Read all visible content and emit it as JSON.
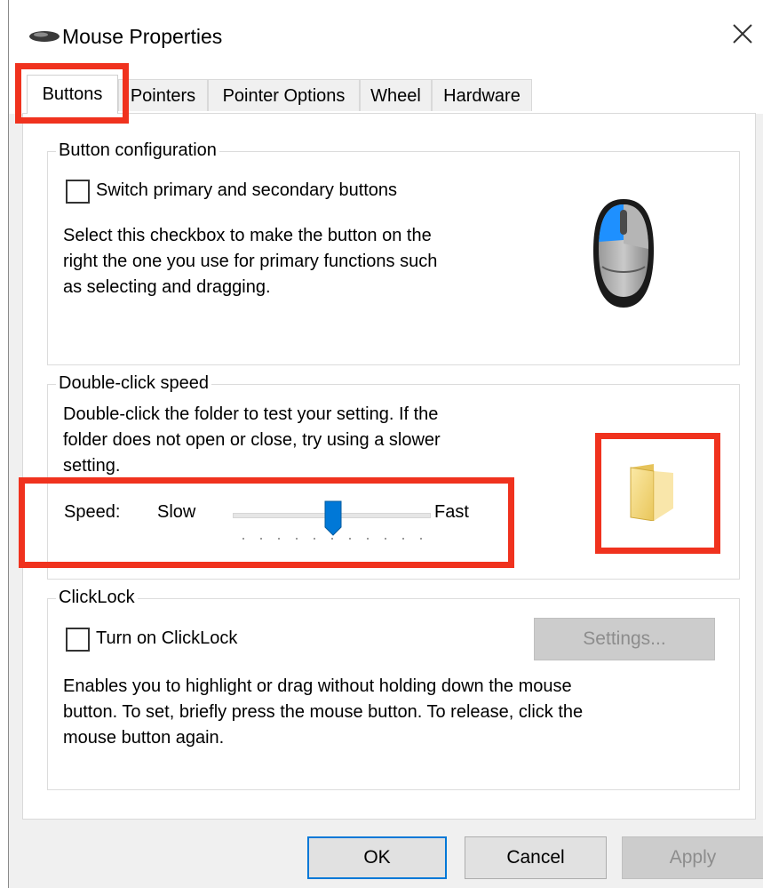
{
  "window": {
    "title": "Mouse Properties",
    "close_glyph": "✕"
  },
  "tabs": [
    {
      "label": "Buttons",
      "active": true
    },
    {
      "label": "Pointers",
      "active": false
    },
    {
      "label": "Pointer Options",
      "active": false
    },
    {
      "label": "Wheel",
      "active": false
    },
    {
      "label": "Hardware",
      "active": false
    }
  ],
  "button_configuration": {
    "legend": "Button configuration",
    "switch_label": "Switch primary and secondary buttons",
    "switch_checked": false,
    "description": [
      "Select this checkbox to make the button on the",
      "right the one you use for primary functions such",
      "as selecting and dragging."
    ]
  },
  "double_click": {
    "legend": "Double-click speed",
    "description": [
      "Double-click the folder to test your setting. If the",
      "folder does not open or close, try using a slower",
      "setting."
    ],
    "speed_label": "Speed:",
    "slow_label": "Slow",
    "fast_label": "Fast",
    "slider_position": 0.5
  },
  "clicklock": {
    "legend": "ClickLock",
    "checkbox_label": "Turn on ClickLock",
    "checked": false,
    "settings_button": "Settings...",
    "description": [
      "Enables you to highlight or drag without holding down the mouse",
      "button. To set, briefly press the mouse button. To release, click the",
      "mouse button again."
    ]
  },
  "footer": {
    "ok": "OK",
    "cancel": "Cancel",
    "apply": "Apply"
  },
  "colors": {
    "highlight": "#f0321e",
    "accent": "#0078d7",
    "folder": "#f5d77a"
  },
  "icons": [
    "mouse-title-icon",
    "close-icon",
    "mouse-illustration-icon",
    "folder-icon"
  ]
}
